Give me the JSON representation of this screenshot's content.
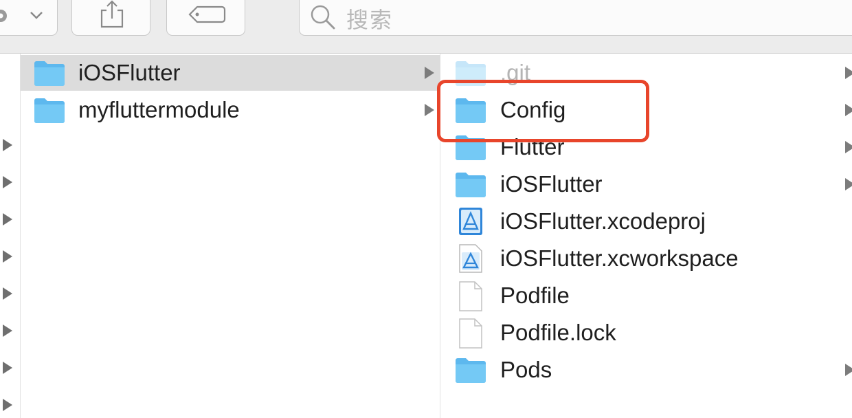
{
  "toolbar": {
    "search_placeholder": "搜索",
    "icons": [
      "gear-icon",
      "chevron-down-icon",
      "share-icon",
      "tag-icon",
      "search-icon"
    ]
  },
  "column1": {
    "items": [
      {
        "label": "iOSFlutter",
        "icon": "folder-icon",
        "selected": true,
        "has_children": true
      },
      {
        "label": "myfluttermodule",
        "icon": "folder-icon",
        "selected": false,
        "has_children": true
      }
    ]
  },
  "column2": {
    "items": [
      {
        "label": ".git",
        "icon": "folder-icon",
        "dimmed": true,
        "has_children": true
      },
      {
        "label": "Config",
        "icon": "folder-icon",
        "has_children": true
      },
      {
        "label": "Flutter",
        "icon": "folder-icon",
        "has_children": true
      },
      {
        "label": "iOSFlutter",
        "icon": "folder-icon",
        "has_children": true
      },
      {
        "label": "iOSFlutter.xcodeproj",
        "icon": "xcode-project-icon",
        "has_children": false
      },
      {
        "label": "iOSFlutter.xcworkspace",
        "icon": "xcode-workspace-icon",
        "has_children": false
      },
      {
        "label": "Podfile",
        "icon": "document-icon",
        "has_children": false
      },
      {
        "label": "Podfile.lock",
        "icon": "document-icon",
        "has_children": false
      },
      {
        "label": "Pods",
        "icon": "folder-icon",
        "has_children": true
      }
    ]
  },
  "annotation": {
    "target": "Config",
    "color": "#e8452b"
  },
  "colors": {
    "folder": "#6cc2f2",
    "selection": "#dcdcdc",
    "accent": "#e8452b"
  }
}
